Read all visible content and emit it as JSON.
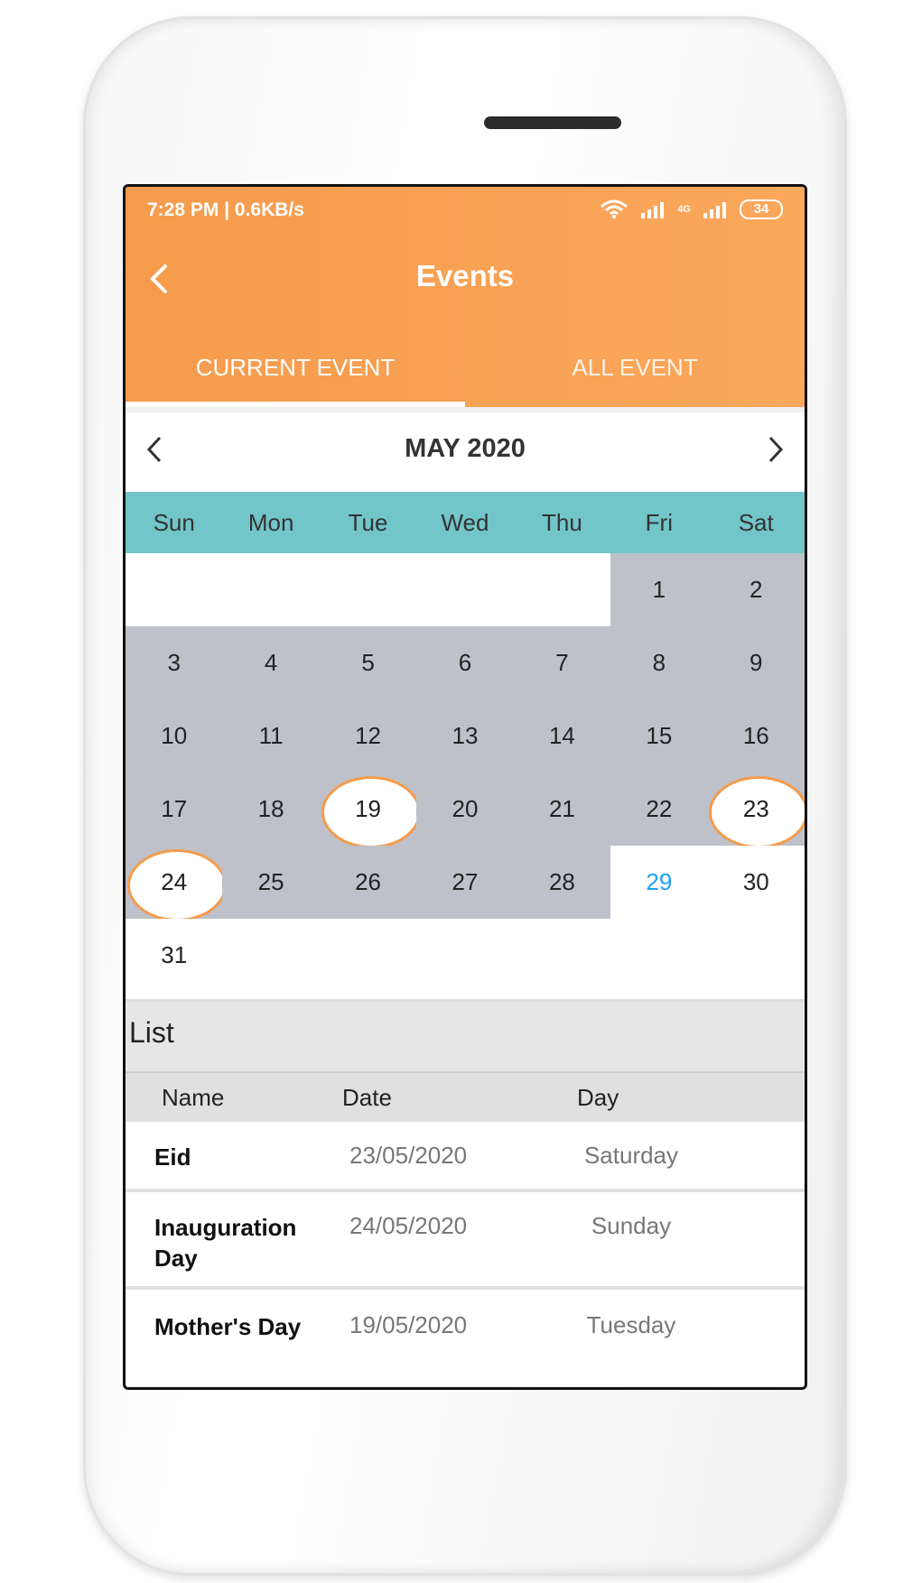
{
  "status_bar": {
    "time_speed": "7:28 PM | 0.6KB/s",
    "network": "4G",
    "battery": "34"
  },
  "header": {
    "title": "Events"
  },
  "tabs": [
    {
      "label": "CURRENT EVENT",
      "active": true
    },
    {
      "label": "ALL EVENT",
      "active": false
    }
  ],
  "calendar": {
    "month_label": "MAY 2020",
    "weekdays": [
      "Sun",
      "Mon",
      "Tue",
      "Wed",
      "Thu",
      "Fri",
      "Sat"
    ],
    "days": [
      {
        "label": ""
      },
      {
        "label": ""
      },
      {
        "label": ""
      },
      {
        "label": ""
      },
      {
        "label": ""
      },
      {
        "label": "1",
        "in_range": true
      },
      {
        "label": "2",
        "in_range": true
      },
      {
        "label": "3",
        "in_range": true
      },
      {
        "label": "4",
        "in_range": true
      },
      {
        "label": "5",
        "in_range": true
      },
      {
        "label": "6",
        "in_range": true
      },
      {
        "label": "7",
        "in_range": true
      },
      {
        "label": "8",
        "in_range": true
      },
      {
        "label": "9",
        "in_range": true
      },
      {
        "label": "10",
        "in_range": true
      },
      {
        "label": "11",
        "in_range": true
      },
      {
        "label": "12",
        "in_range": true
      },
      {
        "label": "13",
        "in_range": true
      },
      {
        "label": "14",
        "in_range": true
      },
      {
        "label": "15",
        "in_range": true
      },
      {
        "label": "16",
        "in_range": true
      },
      {
        "label": "17",
        "in_range": true
      },
      {
        "label": "18",
        "in_range": true
      },
      {
        "label": "19",
        "in_range": true,
        "event": true
      },
      {
        "label": "20",
        "in_range": true
      },
      {
        "label": "21",
        "in_range": true
      },
      {
        "label": "22",
        "in_range": true
      },
      {
        "label": "23",
        "in_range": true,
        "event": true
      },
      {
        "label": "24",
        "in_range": true,
        "event": true
      },
      {
        "label": "25",
        "in_range": true
      },
      {
        "label": "26",
        "in_range": true
      },
      {
        "label": "27",
        "in_range": true
      },
      {
        "label": "28",
        "in_range": true
      },
      {
        "label": "29",
        "today": true
      },
      {
        "label": "30"
      },
      {
        "label": "31"
      },
      {
        "label": ""
      },
      {
        "label": ""
      },
      {
        "label": ""
      },
      {
        "label": ""
      },
      {
        "label": ""
      },
      {
        "label": ""
      }
    ]
  },
  "list": {
    "title": "List",
    "columns": {
      "name": "Name",
      "date": "Date",
      "day": "Day"
    },
    "rows": [
      {
        "name": "Eid",
        "date": "23/05/2020",
        "day": "Saturday"
      },
      {
        "name": "Inauguration Day",
        "date": "24/05/2020",
        "day": "Sunday"
      },
      {
        "name": "Mother's Day",
        "date": "19/05/2020",
        "day": "Tuesday"
      }
    ]
  },
  "colors": {
    "header_orange": "#f59b4c",
    "weekday_teal": "#72c5c8",
    "range_gray": "#bec1c9",
    "today_blue": "#1da1f2",
    "event_ring": "#f59b4c"
  }
}
